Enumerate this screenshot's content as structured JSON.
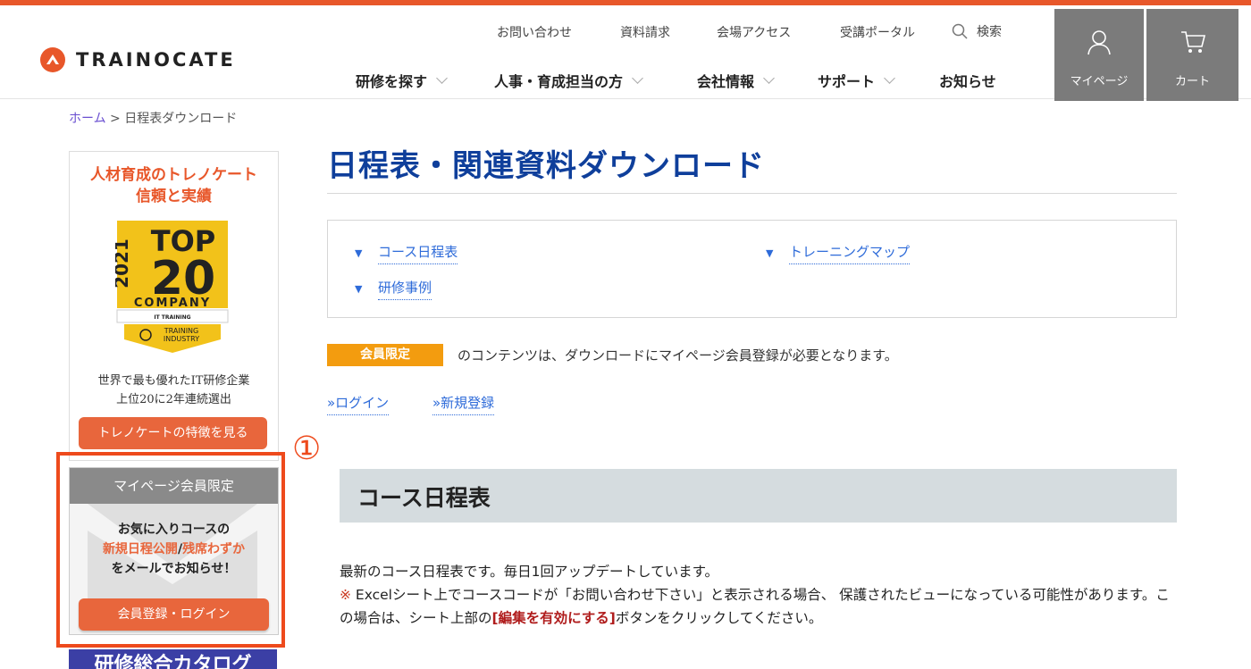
{
  "header": {
    "logo_text": "TRAINOCATE",
    "util_nav": [
      "お問い合わせ",
      "資料請求",
      "会場アクセス",
      "受講ポータル"
    ],
    "search_label": "検索",
    "main_nav": [
      "研修を探す",
      "人事・育成担当の方",
      "会社情報",
      "サポート",
      "お知らせ"
    ],
    "mypage_label": "マイページ",
    "cart_label": "カート"
  },
  "breadcrumb": {
    "home": "ホーム",
    "sep": " > ",
    "current": "日程表ダウンロード"
  },
  "sidebar": {
    "banner_title_1": "人材育成のトレノケート",
    "banner_title_2": "信頼と実績",
    "award": {
      "year": "2021",
      "top": "TOP",
      "rank": "20",
      "company": "COMPANY",
      "category": "IT TRAINING",
      "org_1": "TRAINING",
      "org_2": "INDUSTRY"
    },
    "banner_text_1": "世界で最も優れたIT研修企業",
    "banner_text_2": "上位20に2年連続選出",
    "banner_button": "トレノケートの特徴を見る",
    "mypage_head": "マイページ会員限定",
    "mypage_line1": "お気に入りコースの",
    "mypage_hl1": "新規日程公開",
    "mypage_slash": "/",
    "mypage_hl2": "残席わずか",
    "mypage_line3": "をメールでお知らせ！",
    "mypage_button": "会員登録・ログイン",
    "catalog_label": "研修総合カタログ"
  },
  "annotation": {
    "number": "①",
    "color": "#ee4a1c"
  },
  "main": {
    "title": "日程表・関連資料ダウンロード",
    "toc": [
      "コース日程表",
      "トレーニングマップ",
      "研修事例"
    ],
    "members_badge": "会員限定",
    "members_text": "のコンテンツは、ダウンロードにマイページ会員登録が必要となります。",
    "login_link": "»ログイン",
    "register_link": "»新規登録",
    "section_title": "コース日程表",
    "desc_line1": "最新のコース日程表です。毎日1回アップデートしています。",
    "desc_mark": "※",
    "desc_line2a": " Excelシート上でコースコードが「お問い合わせ下さい」と表示される場合、 保護されたビューになっている可能性があります。この場合は、シート上部の",
    "desc_strong": "[編集を有効にする]",
    "desc_line2b": "ボタンをクリックしてください。"
  },
  "colors": {
    "accent": "#e8572a",
    "title_blue": "#0f3f9b",
    "link_blue": "#2e6bd9",
    "badge_orange": "#f39c0f",
    "header_btn_gray": "#7b7b7b"
  }
}
